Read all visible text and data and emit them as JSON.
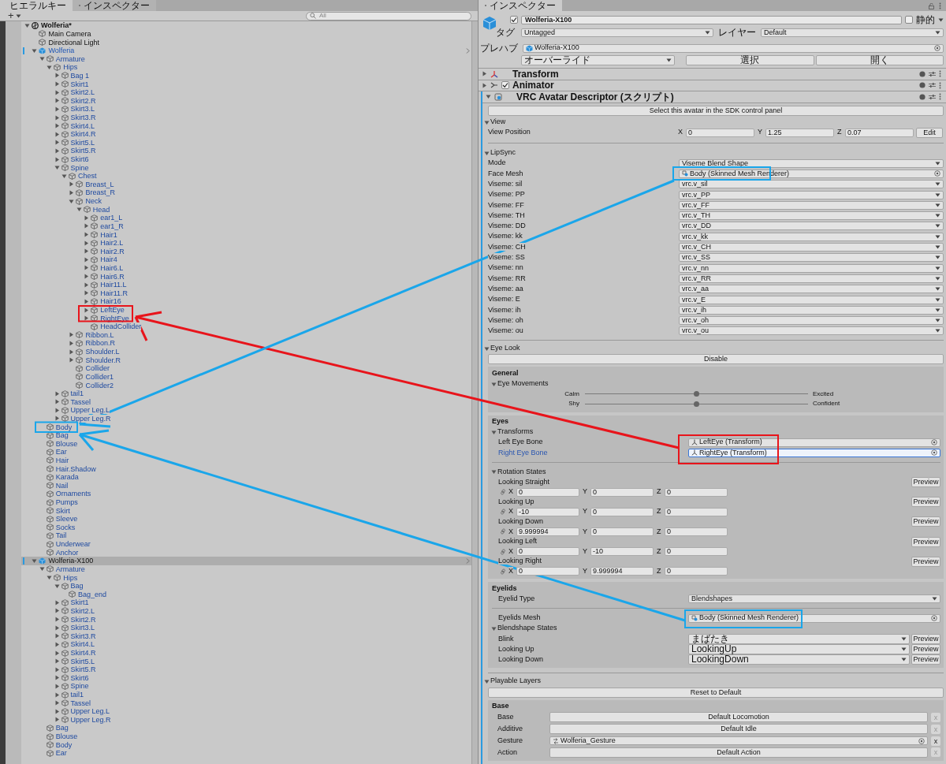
{
  "hierarchy": {
    "tabs": [
      {
        "label": "ヒエラルキー",
        "selected": true
      },
      {
        "label": "インスペクター",
        "selected": false
      }
    ],
    "add_button": "+",
    "search_placeholder": "All",
    "tree": [
      {
        "name": "Wolferia*",
        "kind": "scene",
        "expanded": true,
        "selected": false,
        "children": [
          {
            "name": "Main Camera",
            "kind": "object",
            "selected": false
          },
          {
            "name": "Directional Light",
            "kind": "object",
            "selected": false
          },
          {
            "name": "Wolferia",
            "kind": "prefab",
            "expanded": true,
            "selected": false,
            "children": [
              {
                "name": "Armature",
                "kind": "part",
                "expanded": true,
                "selected": false,
                "children": [
                  {
                    "name": "Hips",
                    "kind": "part",
                    "expanded": true,
                    "selected": false,
                    "children": [
                      {
                        "name": "Bag 1",
                        "kind": "part",
                        "expanded": false,
                        "selected": false
                      },
                      {
                        "name": "Skirt1",
                        "kind": "part",
                        "expanded": false,
                        "selected": false
                      },
                      {
                        "name": "Skirt2.L",
                        "kind": "part",
                        "expanded": false,
                        "selected": false
                      },
                      {
                        "name": "Skirt2.R",
                        "kind": "part",
                        "expanded": false,
                        "selected": false
                      },
                      {
                        "name": "Skirt3.L",
                        "kind": "part",
                        "expanded": false,
                        "selected": false
                      },
                      {
                        "name": "Skirt3.R",
                        "kind": "part",
                        "expanded": false,
                        "selected": false
                      },
                      {
                        "name": "Skirt4.L",
                        "kind": "part",
                        "expanded": false,
                        "selected": false
                      },
                      {
                        "name": "Skirt4.R",
                        "kind": "part",
                        "expanded": false,
                        "selected": false
                      },
                      {
                        "name": "Skirt5.L",
                        "kind": "part",
                        "expanded": false,
                        "selected": false
                      },
                      {
                        "name": "Skirt5.R",
                        "kind": "part",
                        "expanded": false,
                        "selected": false
                      },
                      {
                        "name": "Skirt6",
                        "kind": "part",
                        "expanded": false,
                        "selected": false
                      },
                      {
                        "name": "Spine",
                        "kind": "part",
                        "expanded": true,
                        "selected": false,
                        "children": [
                          {
                            "name": "Chest",
                            "kind": "part",
                            "expanded": true,
                            "selected": false,
                            "children": [
                              {
                                "name": "Breast_L",
                                "kind": "part",
                                "expanded": false,
                                "selected": false
                              },
                              {
                                "name": "Breast_R",
                                "kind": "part",
                                "expanded": false,
                                "selected": false
                              },
                              {
                                "name": "Neck",
                                "kind": "part",
                                "expanded": true,
                                "selected": false,
                                "children": [
                                  {
                                    "name": "Head",
                                    "kind": "part",
                                    "expanded": true,
                                    "selected": false,
                                    "children": [
                                      {
                                        "name": "ear1_L",
                                        "kind": "part",
                                        "expanded": false,
                                        "selected": false
                                      },
                                      {
                                        "name": "ear1_R",
                                        "kind": "part",
                                        "expanded": false,
                                        "selected": false
                                      },
                                      {
                                        "name": "Hair1",
                                        "kind": "part",
                                        "expanded": false,
                                        "selected": false
                                      },
                                      {
                                        "name": "Hair2.L",
                                        "kind": "part",
                                        "expanded": false,
                                        "selected": false
                                      },
                                      {
                                        "name": "Hair2.R",
                                        "kind": "part",
                                        "expanded": false,
                                        "selected": false
                                      },
                                      {
                                        "name": "Hair4",
                                        "kind": "part",
                                        "expanded": false,
                                        "selected": false
                                      },
                                      {
                                        "name": "Hair6.L",
                                        "kind": "part",
                                        "expanded": false,
                                        "selected": false
                                      },
                                      {
                                        "name": "Hair6.R",
                                        "kind": "part",
                                        "expanded": false,
                                        "selected": false
                                      },
                                      {
                                        "name": "Hair11.L",
                                        "kind": "part",
                                        "expanded": false,
                                        "selected": false
                                      },
                                      {
                                        "name": "Hair11.R",
                                        "kind": "part",
                                        "expanded": false,
                                        "selected": false
                                      },
                                      {
                                        "name": "Hair16",
                                        "kind": "part",
                                        "expanded": false,
                                        "selected": false
                                      },
                                      {
                                        "name": "LeftEye",
                                        "kind": "part",
                                        "expanded": false,
                                        "selected": false
                                      },
                                      {
                                        "name": "RightEye",
                                        "kind": "part",
                                        "expanded": false,
                                        "selected": false
                                      },
                                      {
                                        "name": "HeadCollider",
                                        "kind": "part",
                                        "selected": false
                                      }
                                    ]
                                  }
                                ]
                              },
                              {
                                "name": "Ribbon.L",
                                "kind": "part",
                                "expanded": false,
                                "selected": false
                              },
                              {
                                "name": "Ribbon.R",
                                "kind": "part",
                                "expanded": false,
                                "selected": false
                              },
                              {
                                "name": "Shoulder.L",
                                "kind": "part",
                                "expanded": false,
                                "selected": false
                              },
                              {
                                "name": "Shoulder.R",
                                "kind": "part",
                                "expanded": false,
                                "selected": false
                              },
                              {
                                "name": "Collider",
                                "kind": "part",
                                "selected": false
                              },
                              {
                                "name": "Collider1",
                                "kind": "part",
                                "selected": false
                              },
                              {
                                "name": "Collider2",
                                "kind": "part",
                                "selected": false
                              }
                            ]
                          }
                        ]
                      },
                      {
                        "name": "tail1",
                        "kind": "part",
                        "expanded": false,
                        "selected": false
                      },
                      {
                        "name": "Tassel",
                        "kind": "part",
                        "expanded": false,
                        "selected": false
                      },
                      {
                        "name": "Upper Leg.L",
                        "kind": "part",
                        "expanded": false,
                        "selected": false
                      },
                      {
                        "name": "Upper Leg.R",
                        "kind": "part",
                        "expanded": false,
                        "selected": false
                      }
                    ]
                  }
                ]
              },
              {
                "name": "Body",
                "kind": "part",
                "selected": false
              },
              {
                "name": "Bag",
                "kind": "part",
                "selected": false
              },
              {
                "name": "Blouse",
                "kind": "part",
                "selected": false
              },
              {
                "name": "Ear",
                "kind": "part",
                "selected": false
              },
              {
                "name": "Hair",
                "kind": "part",
                "selected": false
              },
              {
                "name": "Hair.Shadow",
                "kind": "part",
                "selected": false
              },
              {
                "name": "Karada",
                "kind": "part",
                "selected": false
              },
              {
                "name": "Nail",
                "kind": "part",
                "selected": false
              },
              {
                "name": "Ornaments",
                "kind": "part",
                "selected": false
              },
              {
                "name": "Pumps",
                "kind": "part",
                "selected": false
              },
              {
                "name": "Skirt",
                "kind": "part",
                "selected": false
              },
              {
                "name": "Sleeve",
                "kind": "part",
                "selected": false
              },
              {
                "name": "Socks",
                "kind": "part",
                "selected": false
              },
              {
                "name": "Tail",
                "kind": "part",
                "selected": false
              },
              {
                "name": "Underwear",
                "kind": "part",
                "selected": false
              },
              {
                "name": "Anchor",
                "kind": "part",
                "selected": false
              }
            ]
          },
          {
            "name": "Wolferia-X100",
            "kind": "prefab",
            "expanded": true,
            "selected": true,
            "children": [
              {
                "name": "Armature",
                "kind": "part",
                "expanded": true,
                "selected": false,
                "children": [
                  {
                    "name": "Hips",
                    "kind": "part",
                    "expanded": true,
                    "selected": false,
                    "children": [
                      {
                        "name": "Bag",
                        "kind": "part",
                        "expanded": true,
                        "selected": false,
                        "children": [
                          {
                            "name": "Bag_end",
                            "kind": "part",
                            "selected": false
                          }
                        ]
                      },
                      {
                        "name": "Skirt1",
                        "kind": "part",
                        "expanded": false,
                        "selected": false
                      },
                      {
                        "name": "Skirt2.L",
                        "kind": "part",
                        "expanded": false,
                        "selected": false
                      },
                      {
                        "name": "Skirt2.R",
                        "kind": "part",
                        "expanded": false,
                        "selected": false
                      },
                      {
                        "name": "Skirt3.L",
                        "kind": "part",
                        "expanded": false,
                        "selected": false
                      },
                      {
                        "name": "Skirt3.R",
                        "kind": "part",
                        "expanded": false,
                        "selected": false
                      },
                      {
                        "name": "Skirt4.L",
                        "kind": "part",
                        "expanded": false,
                        "selected": false
                      },
                      {
                        "name": "Skirt4.R",
                        "kind": "part",
                        "expanded": false,
                        "selected": false
                      },
                      {
                        "name": "Skirt5.L",
                        "kind": "part",
                        "expanded": false,
                        "selected": false
                      },
                      {
                        "name": "Skirt5.R",
                        "kind": "part",
                        "expanded": false,
                        "selected": false
                      },
                      {
                        "name": "Skirt6",
                        "kind": "part",
                        "expanded": false,
                        "selected": false
                      },
                      {
                        "name": "Spine",
                        "kind": "part",
                        "expanded": false,
                        "selected": false
                      },
                      {
                        "name": "tail1",
                        "kind": "part",
                        "expanded": false,
                        "selected": false
                      },
                      {
                        "name": "Tassel",
                        "kind": "part",
                        "expanded": false,
                        "selected": false
                      },
                      {
                        "name": "Upper Leg.L",
                        "kind": "part",
                        "expanded": false,
                        "selected": false
                      },
                      {
                        "name": "Upper Leg.R",
                        "kind": "part",
                        "expanded": false,
                        "selected": false
                      }
                    ]
                  }
                ]
              },
              {
                "name": "Bag",
                "kind": "part",
                "selected": false
              },
              {
                "name": "Blouse",
                "kind": "part",
                "selected": false
              },
              {
                "name": "Body",
                "kind": "part",
                "selected": false
              },
              {
                "name": "Ear",
                "kind": "part",
                "selected": false
              }
            ]
          }
        ]
      }
    ]
  },
  "inspector": {
    "tab": "インスペクター",
    "object": {
      "active": true,
      "name": "Wolferia-X100",
      "static_label": "静的",
      "static": false,
      "tag_label": "タグ",
      "tag": "Untagged",
      "layer_label": "レイヤー",
      "layer": "Default"
    },
    "prefab": {
      "label": "プレハブ",
      "asset": "Wolferia-X100",
      "overrides": "オーバーライド",
      "select": "選択",
      "open": "開く"
    },
    "components": [
      {
        "title": "Transform",
        "kind": "transform",
        "expanded": false
      },
      {
        "title": "Animator",
        "kind": "animator",
        "expanded": false,
        "enabled": true
      },
      {
        "title": "VRC Avatar Descriptor (スクリプト)",
        "kind": "script",
        "expanded": true
      }
    ],
    "descriptor": {
      "sdk_button": "Select this avatar in the SDK control panel",
      "view": {
        "title": "View",
        "expanded": true,
        "label": "View Position",
        "fields": [
          {
            "axis": "X",
            "value": "0"
          },
          {
            "axis": "Y",
            "value": "1.25"
          },
          {
            "axis": "Z",
            "value": "0.07"
          }
        ],
        "edit": "Edit"
      },
      "lipsync": {
        "title": "LipSync",
        "expanded": true,
        "rows": [
          {
            "label": "Mode",
            "kind": "dropdown",
            "value": "Viseme Blend Shape"
          },
          {
            "label": "Face Mesh",
            "kind": "object",
            "value": "Body (Skinned Mesh Renderer)"
          },
          {
            "label": "Viseme: sil",
            "kind": "dropdown",
            "value": "vrc.v_sil"
          },
          {
            "label": "Viseme: PP",
            "kind": "dropdown",
            "value": "vrc.v_PP"
          },
          {
            "label": "Viseme: FF",
            "kind": "dropdown",
            "value": "vrc.v_FF"
          },
          {
            "label": "Viseme: TH",
            "kind": "dropdown",
            "value": "vrc.v_TH"
          },
          {
            "label": "Viseme: DD",
            "kind": "dropdown",
            "value": "vrc.v_DD"
          },
          {
            "label": "Viseme: kk",
            "kind": "dropdown",
            "value": "vrc.v_kk"
          },
          {
            "label": "Viseme: CH",
            "kind": "dropdown",
            "value": "vrc.v_CH"
          },
          {
            "label": "Viseme: SS",
            "kind": "dropdown",
            "value": "vrc.v_SS"
          },
          {
            "label": "Viseme: nn",
            "kind": "dropdown",
            "value": "vrc.v_nn"
          },
          {
            "label": "Viseme: RR",
            "kind": "dropdown",
            "value": "vrc.v_RR"
          },
          {
            "label": "Viseme: aa",
            "kind": "dropdown",
            "value": "vrc.v_aa"
          },
          {
            "label": "Viseme: E",
            "kind": "dropdown",
            "value": "vrc.v_E"
          },
          {
            "label": "Viseme: ih",
            "kind": "dropdown",
            "value": "vrc.v_ih"
          },
          {
            "label": "Viseme: oh",
            "kind": "dropdown",
            "value": "vrc.v_oh"
          },
          {
            "label": "Viseme: ou",
            "kind": "dropdown",
            "value": "vrc.v_ou"
          }
        ]
      },
      "eye_look": {
        "title": "Eye Look",
        "expanded": true,
        "disable": "Disable",
        "general": {
          "title": "General",
          "movements": {
            "title": "Eye Movements",
            "expanded": true,
            "sliders": [
              {
                "left": "Calm",
                "right": "Excited",
                "level": 0.5
              },
              {
                "left": "Shy",
                "right": "Confident",
                "level": 0.5
              }
            ]
          }
        },
        "eyes": {
          "title": "Eyes",
          "transforms": {
            "title": "Transforms",
            "expanded": true,
            "rows": [
              {
                "label": "Left Eye Bone",
                "value": "LeftEye (Transform)",
                "focused": false
              },
              {
                "label": "Right Eye Bone",
                "value": "RightEye (Transform)",
                "focused": true
              }
            ]
          },
          "rotation": {
            "title": "Rotation States",
            "expanded": true,
            "states": [
              {
                "label": "Looking Straight",
                "fields": [
                  {
                    "axis": "X",
                    "value": "0"
                  },
                  {
                    "axis": "Y",
                    "value": "0"
                  },
                  {
                    "axis": "Z",
                    "value": "0"
                  }
                ],
                "preview": "Preview"
              },
              {
                "label": "Looking Up",
                "fields": [
                  {
                    "axis": "X",
                    "value": "-10"
                  },
                  {
                    "axis": "Y",
                    "value": "0"
                  },
                  {
                    "axis": "Z",
                    "value": "0"
                  }
                ],
                "preview": "Preview"
              },
              {
                "label": "Looking Down",
                "fields": [
                  {
                    "axis": "X",
                    "value": "9.999994"
                  },
                  {
                    "axis": "Y",
                    "value": "0"
                  },
                  {
                    "axis": "Z",
                    "value": "0"
                  }
                ],
                "preview": "Preview"
              },
              {
                "label": "Looking Left",
                "fields": [
                  {
                    "axis": "X",
                    "value": "0"
                  },
                  {
                    "axis": "Y",
                    "value": "-10"
                  },
                  {
                    "axis": "Z",
                    "value": "0"
                  }
                ],
                "preview": "Preview"
              },
              {
                "label": "Looking Right",
                "fields": [
                  {
                    "axis": "X",
                    "value": "0"
                  },
                  {
                    "axis": "Y",
                    "value": "9.999994"
                  },
                  {
                    "axis": "Z",
                    "value": "0"
                  }
                ],
                "preview": "Preview"
              }
            ]
          }
        },
        "eyelids": {
          "title": "Eyelids",
          "type_label": "Eyelid Type",
          "type": "Blendshapes",
          "mesh_label": "Eyelids Mesh",
          "mesh": "Body (Skinned Mesh Renderer)",
          "blendshapes": {
            "title": "Blendshape States",
            "expanded": true,
            "rows": [
              {
                "label": "Blink",
                "value": "まばたき",
                "preview": "Preview"
              },
              {
                "label": "Looking Up",
                "value": "LookingUp",
                "preview": "Preview"
              },
              {
                "label": "Looking Down",
                "value": "LookingDown",
                "preview": "Preview"
              }
            ]
          }
        }
      },
      "playable": {
        "title": "Playable Layers",
        "expanded": true,
        "reset": "Reset to Default",
        "base": {
          "title": "Base",
          "layers": [
            {
              "label": "Base",
              "kind": "default",
              "value": "Default Locomotion",
              "remove": "x"
            },
            {
              "label": "Additive",
              "kind": "default",
              "value": "Default Idle",
              "remove": "x"
            },
            {
              "label": "Gesture",
              "kind": "asset",
              "value": "Wolferia_Gesture",
              "remove": "x"
            },
            {
              "label": "Action",
              "kind": "default",
              "value": "Default Action",
              "remove": "x"
            }
          ]
        }
      }
    }
  },
  "annotations": [
    {
      "kind": "frame",
      "color": "#e8141b"
    },
    {
      "kind": "frame",
      "color": "#e8141b"
    },
    {
      "kind": "arrow",
      "color": "#e8141b"
    },
    {
      "kind": "frame",
      "color": "#1aa6ea"
    },
    {
      "kind": "frame",
      "color": "#1aa6ea"
    },
    {
      "kind": "frame",
      "color": "#1aa6ea"
    },
    {
      "kind": "arrow",
      "color": "#1aa6ea"
    },
    {
      "kind": "arrow",
      "color": "#1aa6ea"
    }
  ]
}
